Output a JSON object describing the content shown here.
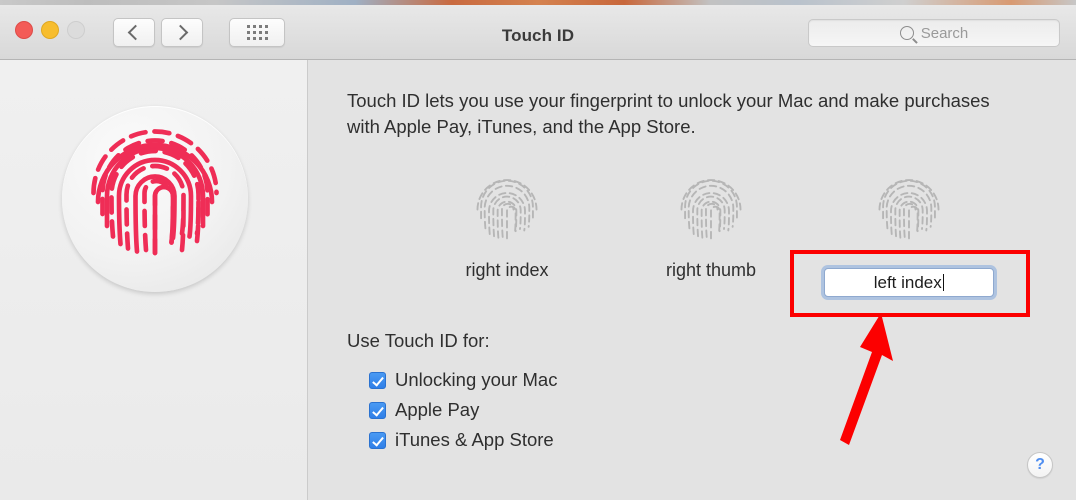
{
  "window": {
    "title": "Touch ID",
    "traffic_lights": [
      {
        "name": "close",
        "color": "#f35b57"
      },
      {
        "name": "minimize",
        "color": "#f7bd2e"
      },
      {
        "name": "zoom",
        "color": "#dcdcdc"
      }
    ],
    "nav": {
      "back_icon": "chevron-left-icon",
      "forward_icon": "chevron-right-icon"
    },
    "show_all_icon": "grid-icon",
    "search": {
      "placeholder": "Search",
      "value": "",
      "icon": "search-icon"
    }
  },
  "sidebar": {
    "icon_name": "touch-id-fingerprint-icon",
    "icon_color": "#ef2d56"
  },
  "main": {
    "description": "Touch ID lets you use your fingerprint to unlock your Mac and make purchases with Apple Pay, iTunes, and the App Store.",
    "prints": [
      {
        "label": "right index",
        "icon": "fingerprint-icon",
        "editing": false
      },
      {
        "label": "right thumb",
        "icon": "fingerprint-icon",
        "editing": false
      },
      {
        "label": "left index",
        "icon": "fingerprint-icon",
        "editing": true
      }
    ],
    "name_field": {
      "value": "left index",
      "placeholder": "Finger Name",
      "focused": true
    },
    "use_for_label": "Use Touch ID for:",
    "options": [
      {
        "label": "Unlocking your Mac",
        "checked": true
      },
      {
        "label": "Apple Pay",
        "checked": true
      },
      {
        "label": "iTunes & App Store",
        "checked": true
      }
    ],
    "help_label": "?"
  },
  "annotation": {
    "highlight_color": "#fc0000",
    "box_target": "left-index-name-field",
    "arrow_direction": "up-right"
  }
}
